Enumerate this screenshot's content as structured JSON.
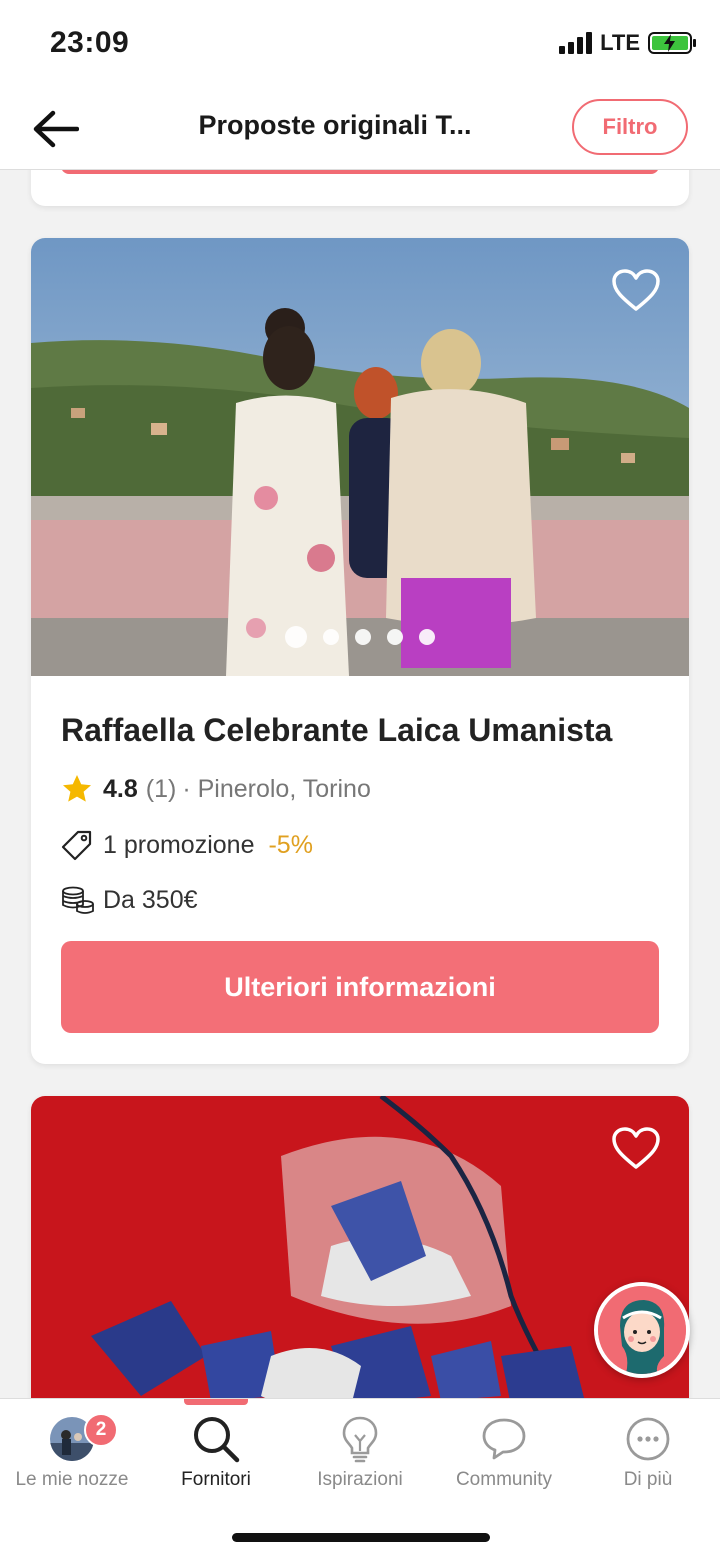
{
  "status": {
    "time": "23:09",
    "network": "LTE"
  },
  "header": {
    "title": "Proposte originali T...",
    "filter_label": "Filtro"
  },
  "listing": {
    "name": "Raffaella Celebrante Laica Umanista",
    "rating": "4.8",
    "reviews": "(1)",
    "location": "· Pinerolo, Torino",
    "promotion": "1 promozione",
    "discount": "-5%",
    "price": "Da 350€",
    "cta": "Ulteriori informazioni",
    "photo_count": 5,
    "active_photo": 1
  },
  "tabs": [
    {
      "label": "Le mie nozze",
      "icon": "avatar-icon",
      "badge": "2"
    },
    {
      "label": "Fornitori",
      "icon": "search-icon",
      "active": true
    },
    {
      "label": "Ispirazioni",
      "icon": "lightbulb-icon"
    },
    {
      "label": "Community",
      "icon": "chat-bubble-icon"
    },
    {
      "label": "Di più",
      "icon": "more-icon"
    }
  ],
  "colors": {
    "accent": "#f16b73",
    "discount": "#e0a020",
    "star": "#f5b800"
  }
}
